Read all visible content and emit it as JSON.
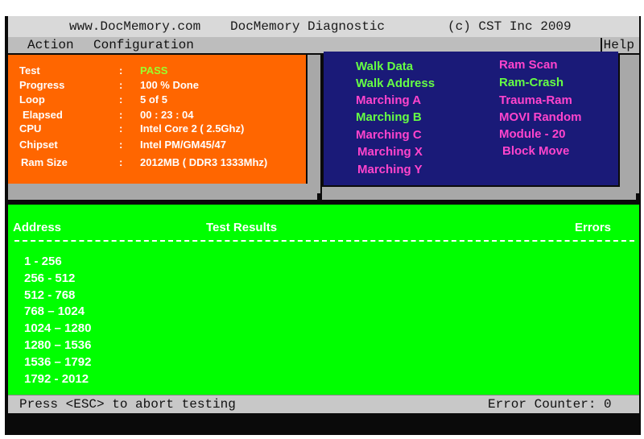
{
  "titlebar": {
    "url": "www.DocMemory.com",
    "title": "DocMemory Diagnostic",
    "copyright": "(c) CST Inc 2009"
  },
  "menu": {
    "action": "Action",
    "configuration": "Configuration",
    "help": "Help"
  },
  "info": [
    {
      "label": "Test",
      "value": "PASS"
    },
    {
      "label": "Progress",
      "value": "100 % Done"
    },
    {
      "label": "Loop",
      "value": "5 of 5"
    },
    {
      "label": "Elapsed",
      "value": "00 : 23 : 04"
    },
    {
      "label": "CPU",
      "value": "Intel Core 2 ( 2.5Ghz)"
    },
    {
      "label": "Chipset",
      "value": "Intel PM/GM45/47"
    },
    {
      "label": "Ram Size",
      "value": "2012MB  ( DDR3 1333Mhz)"
    }
  ],
  "info_separator": ":",
  "tests": {
    "col1": [
      "Walk Data",
      "Walk Address",
      "Marching A",
      "Marching B",
      "Marching C",
      "Marching X",
      "Marching Y"
    ],
    "col2": [
      "Ram Scan",
      "Ram-Crash",
      "Trauma-Ram",
      "MOVI Random",
      "Module - 20",
      "Block Move"
    ]
  },
  "colors": {
    "test_green": "#66ff44",
    "test_pink": "#ff44cc"
  },
  "results": {
    "headers": {
      "address": "Address",
      "results": "Test Results",
      "errors": "Errors"
    },
    "rows": [
      "1  -  256",
      "256  - 512",
      "512  - 768",
      "768 – 1024",
      "1024 – 1280",
      "1280 – 1536",
      "1536 – 1792",
      "1792 - 2012"
    ]
  },
  "status": {
    "hint": "Press <ESC> to abort testing",
    "error_counter": "Error Counter: 0"
  }
}
